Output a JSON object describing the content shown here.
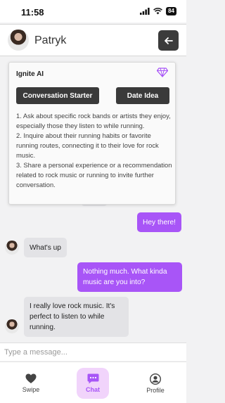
{
  "status_bar": {
    "time": "11:58",
    "battery": "84"
  },
  "header": {
    "name": "Patryk"
  },
  "ai_panel": {
    "title": "Ignite AI",
    "buttons": [
      "Conversation Starter",
      "Date Idea"
    ],
    "suggestions": [
      "1. Ask about specific rock bands or artists they enjoy, especially those they listen to while running.",
      "2. Inquire about their running habits or favorite running routes, connecting it to their love for rock music.",
      "3. Share a personal experience or a recommendation related to rock music or running to invite further conversation."
    ]
  },
  "messages": [
    {
      "from": "me",
      "text": "Hey there!"
    },
    {
      "from": "them",
      "text": "What's up"
    },
    {
      "from": "me",
      "text": "Nothing much. What kinda music are you into?"
    },
    {
      "from": "them",
      "text": "I really love rock music. It's perfect to listen to while running."
    }
  ],
  "composer": {
    "placeholder": "Type a message..."
  },
  "tabs": [
    {
      "label": "Swipe",
      "icon": "heart-icon"
    },
    {
      "label": "Chat",
      "icon": "chat-icon"
    },
    {
      "label": "Profile",
      "icon": "profile-icon"
    }
  ],
  "colors": {
    "accent": "#a855f7",
    "dark_button": "#3a3a3a",
    "them_bubble": "#e3e3e6"
  }
}
